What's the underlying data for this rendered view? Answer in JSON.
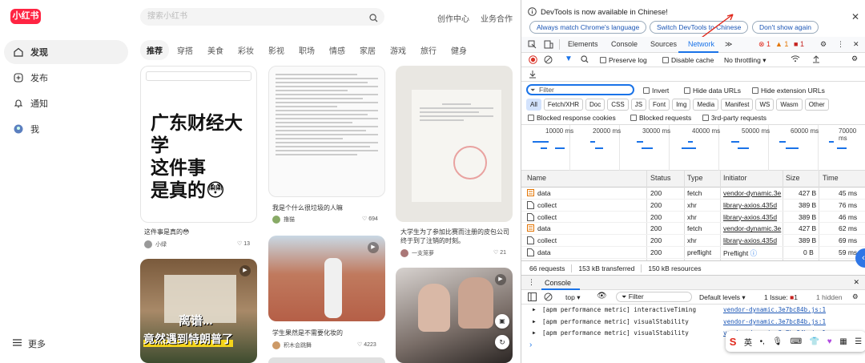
{
  "app": {
    "logo": "小红书",
    "nav": [
      {
        "label": "发现",
        "icon": "home-icon"
      },
      {
        "label": "发布",
        "icon": "plus-icon"
      },
      {
        "label": "通知",
        "icon": "bell-icon"
      },
      {
        "label": "我",
        "icon": "avatar-icon"
      }
    ],
    "more": "更多",
    "search_placeholder": "搜索小红书",
    "creator_center": "创作中心",
    "business": "业务合作",
    "categories": [
      "推荐",
      "穿搭",
      "美食",
      "彩妆",
      "影视",
      "职场",
      "情感",
      "家居",
      "游戏",
      "旅行",
      "健身"
    ],
    "cards": [
      {
        "big": [
          "广东财经大学",
          "这件事",
          "是真的😳"
        ],
        "title": "这件事是真的😳",
        "user": "小绿",
        "likes": "13"
      },
      {
        "title": "我是个什么很垃圾的人嘛",
        "user": "撸猫",
        "likes": "694"
      },
      {
        "title": "大学生为了参加比赛而注册的皮包公司终于到了注销的时刻。",
        "user": "一支笼萝",
        "likes": "21"
      },
      {
        "title": "学生果然是不需要化妆的",
        "user": "积木会跳舞",
        "likes": "4223"
      },
      {
        "overlay": [
          "离谱...",
          "竟然遇到特朗普了"
        ]
      }
    ]
  },
  "devtools": {
    "banner": "DevTools is now available in Chinese!",
    "btn_match": "Always match Chrome's language",
    "btn_switch": "Switch DevTools to Chinese",
    "btn_dont": "Don't show again",
    "tabs": [
      "Elements",
      "Console",
      "Sources",
      "Network"
    ],
    "badges": {
      "errors": "1",
      "warnings": "1",
      "issues": "1"
    },
    "preserve_log": "Preserve log",
    "disable_cache": "Disable cache",
    "throttling": "No throttling",
    "filter_placeholder": "Filter",
    "invert": "Invert",
    "hide_data_urls": "Hide data URLs",
    "hide_ext_urls": "Hide extension URLs",
    "types": [
      "All",
      "Fetch/XHR",
      "Doc",
      "CSS",
      "JS",
      "Font",
      "Img",
      "Media",
      "Manifest",
      "WS",
      "Wasm",
      "Other"
    ],
    "blocked_cookies": "Blocked response cookies",
    "blocked_requests": "Blocked requests",
    "third_party": "3rd-party requests",
    "timeline_labels": [
      "10000 ms",
      "20000 ms",
      "30000 ms",
      "40000 ms",
      "50000 ms",
      "60000 ms",
      "70000 ms"
    ],
    "columns": [
      "Name",
      "Status",
      "Type",
      "Initiator",
      "Size",
      "Time"
    ],
    "requests": [
      {
        "name": "data",
        "status": "200",
        "type": "fetch",
        "initiator": "vendor-dynamic.3e",
        "size": "427 B",
        "time": "45 ms",
        "kind": "fetch"
      },
      {
        "name": "collect",
        "status": "200",
        "type": "xhr",
        "initiator": "library-axios.435d",
        "size": "389 B",
        "time": "76 ms",
        "kind": "doc"
      },
      {
        "name": "collect",
        "status": "200",
        "type": "xhr",
        "initiator": "library-axios.435d",
        "size": "389 B",
        "time": "46 ms",
        "kind": "doc"
      },
      {
        "name": "data",
        "status": "200",
        "type": "fetch",
        "initiator": "vendor-dynamic.3e",
        "size": "427 B",
        "time": "62 ms",
        "kind": "fetch"
      },
      {
        "name": "collect",
        "status": "200",
        "type": "xhr",
        "initiator": "library-axios.435d",
        "size": "389 B",
        "time": "69 ms",
        "kind": "doc"
      },
      {
        "name": "data",
        "status": "200",
        "type": "preflight",
        "initiator": "Preflight",
        "size": "0 B",
        "time": "59 ms",
        "kind": "doc"
      }
    ],
    "summary": [
      "66 requests",
      "153 kB transferred",
      "150 kB resources"
    ],
    "console_tab": "Console",
    "context": "top",
    "console_filter": "Filter",
    "default_levels": "Default levels",
    "issue_count": "1 Issue:",
    "issue_num": "1",
    "hidden": "1 hidden",
    "logs": [
      {
        "text": "[apm performance metric] interactiveTiming",
        "src": "vendor-dynamic.3e7bc84b.js:1"
      },
      {
        "text": "[apm performance metric] visualStability",
        "src": "vendor-dynamic.3e7bc84b.js:1"
      },
      {
        "text": "[apm performance metric] visualStability",
        "src": "vendor-dynamic.3e7bc84b.js:1"
      }
    ],
    "ime_label": "英"
  },
  "colors": {
    "brand": "#ff2442",
    "accent": "#1a73e8",
    "annotation_arrow": "#e0281b"
  }
}
